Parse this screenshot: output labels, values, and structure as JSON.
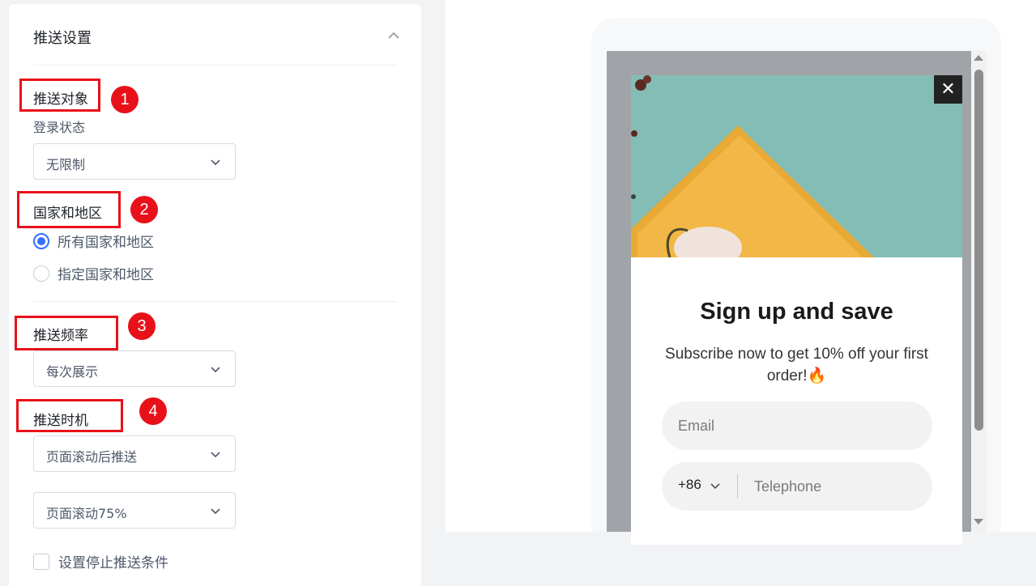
{
  "panel": {
    "title": "推送设置",
    "audience": {
      "badge": "1",
      "label": "推送对象",
      "login_label": "登录状态",
      "login_value": "无限制"
    },
    "region": {
      "badge": "2",
      "label": "国家和地区",
      "options": [
        "所有国家和地区",
        "指定国家和地区"
      ],
      "selected": 0
    },
    "frequency": {
      "badge": "3",
      "label": "推送频率",
      "value": "每次展示"
    },
    "timing": {
      "badge": "4",
      "label": "推送时机",
      "trigger_value": "页面滚动后推送",
      "scroll_value": "页面滚动75%"
    },
    "stop_condition_label": "设置停止推送条件"
  },
  "popup": {
    "close": "✕",
    "title": "Sign up and save",
    "subtitle": "Subscribe now to get 10% off your first order!🔥",
    "email_placeholder": "Email",
    "phone_code": "+86",
    "phone_placeholder": "Telephone"
  },
  "colors": {
    "highlight": "#e8111a",
    "radio_active": "#3370ff",
    "image_teal": "#84bdb5",
    "image_plate": "#f1b13f"
  }
}
